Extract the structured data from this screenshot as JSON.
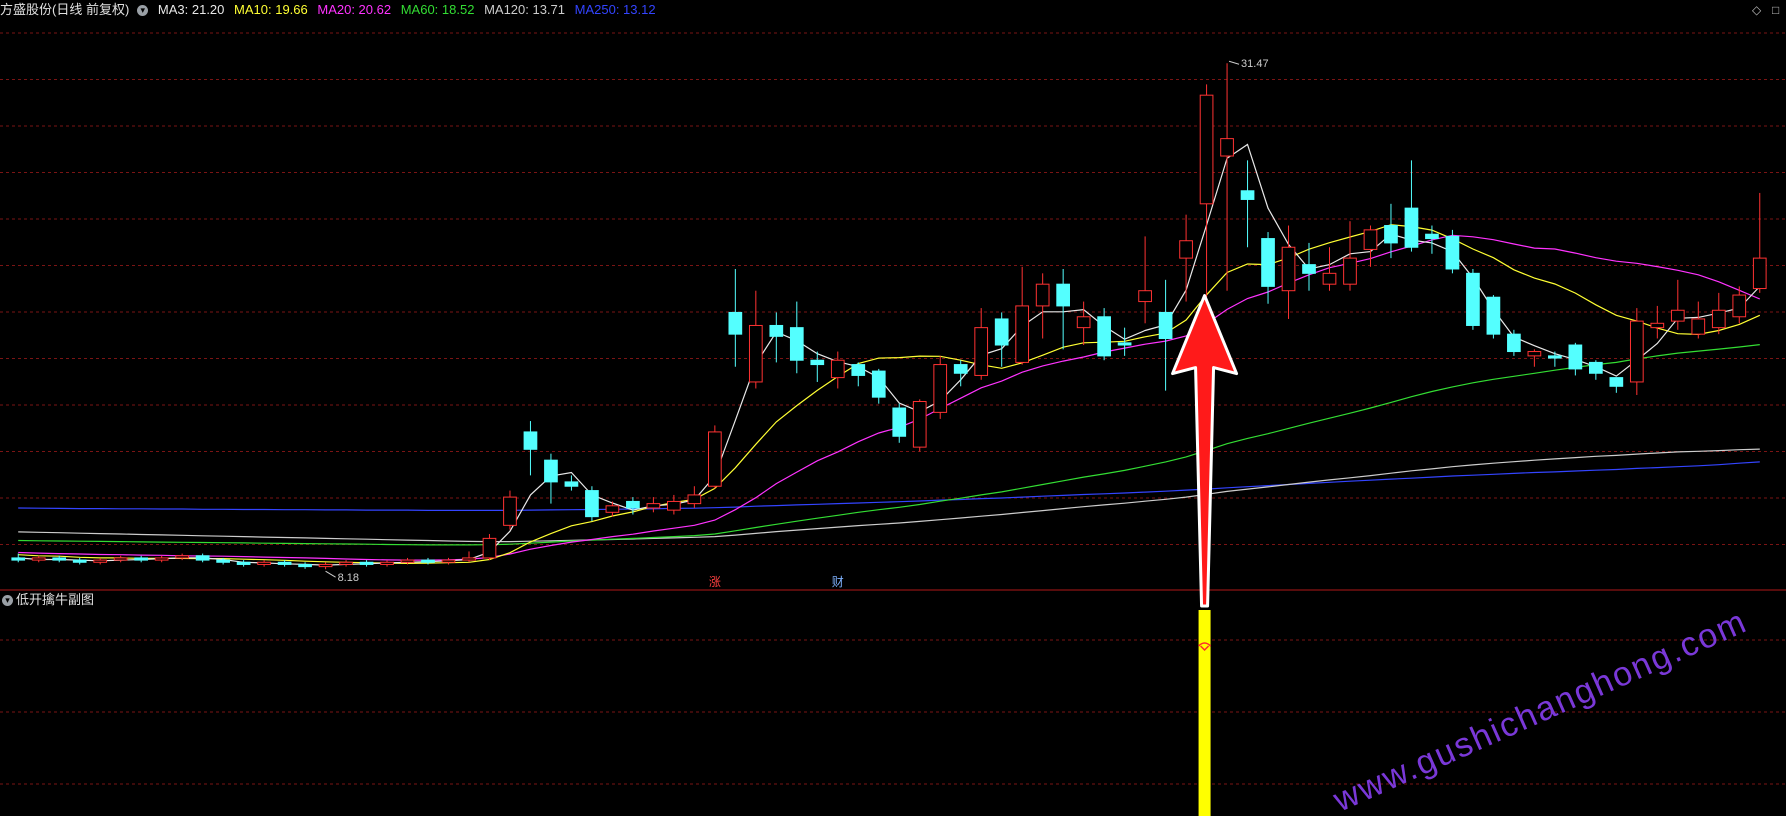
{
  "header": {
    "title": "方盛股份(日线 前复权)",
    "ma_labels": [
      {
        "text": "MA3: 21.20",
        "color": "#e8e8e8"
      },
      {
        "text": "MA10: 19.66",
        "color": "#ffff33"
      },
      {
        "text": "MA20: 20.62",
        "color": "#ff33ff"
      },
      {
        "text": "MA60: 18.52",
        "color": "#33dd33"
      },
      {
        "text": "MA120: 13.71",
        "color": "#cccccc"
      },
      {
        "text": "MA250: 13.12",
        "color": "#3344ff"
      }
    ]
  },
  "subchart": {
    "title": "低开擒牛副图"
  },
  "annotations": {
    "high_label": "31.47",
    "low_label": "8.18",
    "event_zhang": "涨",
    "event_cai": "财"
  },
  "watermark": "www.gushichanghong.com",
  "colors": {
    "up": "#ff3232",
    "down": "#54ffff",
    "grid": "#7a1414",
    "signal": "#ffff00",
    "arrow": "#ff1a1a"
  },
  "chart_data": {
    "type": "candlestick",
    "ylim": [
      7.5,
      33
    ],
    "grid": true,
    "high_marker": 31.47,
    "low_marker": 8.18,
    "candles": [
      [
        8.7,
        8.6,
        8.9,
        8.5
      ],
      [
        8.6,
        8.7,
        8.8,
        8.5
      ],
      [
        8.7,
        8.6,
        8.8,
        8.5
      ],
      [
        8.6,
        8.5,
        8.7,
        8.4
      ],
      [
        8.5,
        8.6,
        8.7,
        8.4
      ],
      [
        8.6,
        8.7,
        8.8,
        8.5
      ],
      [
        8.7,
        8.6,
        8.8,
        8.5
      ],
      [
        8.6,
        8.7,
        8.8,
        8.5
      ],
      [
        8.7,
        8.8,
        8.9,
        8.6
      ],
      [
        8.8,
        8.6,
        8.9,
        8.5
      ],
      [
        8.6,
        8.5,
        8.7,
        8.4
      ],
      [
        8.5,
        8.4,
        8.6,
        8.3
      ],
      [
        8.4,
        8.5,
        8.6,
        8.3
      ],
      [
        8.5,
        8.4,
        8.6,
        8.3
      ],
      [
        8.4,
        8.3,
        8.5,
        8.2
      ],
      [
        8.3,
        8.4,
        8.5,
        8.18
      ],
      [
        8.4,
        8.5,
        8.6,
        8.3
      ],
      [
        8.5,
        8.4,
        8.6,
        8.3
      ],
      [
        8.4,
        8.5,
        8.6,
        8.3
      ],
      [
        8.5,
        8.6,
        8.7,
        8.4
      ],
      [
        8.6,
        8.5,
        8.7,
        8.4
      ],
      [
        8.5,
        8.6,
        8.7,
        8.4
      ],
      [
        8.6,
        8.7,
        9.0,
        8.5
      ],
      [
        8.7,
        9.6,
        9.8,
        8.6
      ],
      [
        10.2,
        11.5,
        11.8,
        10.0
      ],
      [
        14.5,
        13.7,
        15.0,
        12.5
      ],
      [
        13.2,
        12.2,
        13.5,
        11.2
      ],
      [
        12.2,
        12.0,
        12.5,
        11.8
      ],
      [
        11.8,
        10.6,
        12.0,
        10.4
      ],
      [
        10.8,
        11.1,
        11.3,
        10.6
      ],
      [
        11.3,
        11.0,
        11.5,
        10.7
      ],
      [
        11.0,
        11.2,
        11.5,
        10.8
      ],
      [
        10.9,
        11.3,
        11.6,
        10.7
      ],
      [
        11.2,
        11.6,
        12.0,
        11.0
      ],
      [
        12.0,
        14.5,
        14.8,
        11.9
      ],
      [
        20.0,
        19.0,
        22.0,
        17.5
      ],
      [
        16.8,
        19.4,
        21.0,
        16.5
      ],
      [
        19.4,
        18.9,
        20.0,
        17.7
      ],
      [
        19.3,
        17.8,
        20.5,
        17.2
      ],
      [
        17.8,
        17.6,
        18.2,
        16.8
      ],
      [
        17.0,
        17.8,
        18.2,
        16.5
      ],
      [
        17.6,
        17.1,
        17.7,
        16.6
      ],
      [
        17.3,
        16.1,
        17.4,
        15.8
      ],
      [
        15.6,
        14.3,
        15.8,
        14.0
      ],
      [
        13.8,
        15.9,
        16.0,
        13.6
      ],
      [
        15.4,
        17.6,
        18.0,
        15.1
      ],
      [
        17.6,
        17.2,
        17.8,
        16.6
      ],
      [
        17.1,
        19.3,
        20.2,
        16.9
      ],
      [
        19.7,
        18.5,
        20.0,
        17.5
      ],
      [
        17.7,
        20.3,
        22.1,
        17.6
      ],
      [
        20.3,
        21.3,
        21.8,
        18.8
      ],
      [
        21.3,
        20.3,
        22.0,
        18.3
      ],
      [
        19.3,
        19.8,
        20.5,
        18.5
      ],
      [
        19.8,
        18.0,
        20.2,
        17.8
      ],
      [
        18.6,
        18.5,
        19.3,
        18.0
      ],
      [
        20.5,
        21.0,
        23.5,
        19.5
      ],
      [
        20.0,
        18.8,
        21.5,
        16.4
      ],
      [
        22.5,
        23.3,
        24.5,
        20.5
      ],
      [
        25.0,
        30.0,
        30.5,
        20.7
      ],
      [
        27.2,
        28.0,
        31.47,
        21.0
      ],
      [
        25.6,
        25.2,
        27.0,
        23.0
      ],
      [
        23.4,
        21.2,
        23.7,
        20.4
      ],
      [
        21.0,
        23.0,
        24.0,
        19.7
      ],
      [
        22.2,
        21.8,
        23.2,
        21.0
      ],
      [
        21.3,
        21.8,
        23.0,
        21.0
      ],
      [
        21.3,
        22.5,
        24.2,
        21.0
      ],
      [
        22.9,
        23.8,
        24.0,
        22.1
      ],
      [
        24.0,
        23.2,
        25.0,
        22.5
      ],
      [
        24.8,
        23.0,
        27.0,
        22.8
      ],
      [
        23.6,
        23.4,
        24.0,
        22.7
      ],
      [
        23.5,
        22.0,
        23.8,
        21.8
      ],
      [
        21.8,
        19.4,
        22.0,
        19.2
      ],
      [
        20.7,
        19.0,
        20.8,
        18.8
      ],
      [
        19.0,
        18.2,
        19.2,
        18.0
      ],
      [
        18.0,
        18.2,
        18.3,
        17.5
      ],
      [
        18.0,
        17.9,
        18.2,
        17.5
      ],
      [
        18.5,
        17.4,
        18.6,
        17.1
      ],
      [
        17.7,
        17.2,
        17.8,
        16.9
      ],
      [
        17.0,
        16.6,
        17.0,
        16.3
      ],
      [
        16.8,
        19.6,
        20.2,
        16.2
      ],
      [
        19.3,
        19.5,
        20.3,
        18.8
      ],
      [
        19.6,
        20.1,
        21.5,
        19.2
      ],
      [
        19.0,
        19.7,
        20.5,
        18.8
      ],
      [
        19.3,
        20.1,
        20.9,
        19.0
      ],
      [
        19.8,
        20.8,
        21.2,
        19.5
      ],
      [
        21.1,
        22.5,
        25.5,
        20.9
      ]
    ],
    "ma3": [
      8.7,
      8.63,
      8.63,
      8.6,
      8.57,
      8.6,
      8.63,
      8.67,
      8.7,
      8.7,
      8.63,
      8.5,
      8.47,
      8.43,
      8.4,
      8.37,
      8.4,
      8.43,
      8.47,
      8.5,
      8.53,
      8.57,
      8.63,
      8.97,
      9.93,
      11.6,
      12.47,
      12.63,
      11.6,
      11.23,
      10.9,
      11.1,
      11.17,
      11.37,
      12.47,
      15.03,
      17.63,
      19.1,
      18.7,
      18.1,
      17.73,
      17.5,
      17.0,
      15.83,
      15.43,
      15.93,
      16.9,
      18.03,
      18.33,
      19.37,
      20.03,
      20.03,
      20.13,
      19.37,
      18.77,
      19.17,
      19.43,
      21.03,
      24.03,
      27.1,
      27.73,
      24.8,
      23.13,
      22.0,
      22.2,
      22.7,
      22.8,
      23.6,
      23.33,
      23.2,
      22.8,
      21.6,
      20.13,
      18.87,
      18.47,
      18.1,
      17.83,
      17.5,
      17.07,
      17.8,
      18.57,
      19.73,
      19.77,
      19.97,
      20.2,
      21.2
    ],
    "ma10": [
      8.85,
      8.8,
      8.78,
      8.73,
      8.7,
      8.7,
      8.68,
      8.68,
      8.68,
      8.67,
      8.67,
      8.64,
      8.62,
      8.59,
      8.55,
      8.52,
      8.5,
      8.48,
      8.46,
      8.45,
      8.46,
      8.48,
      8.5,
      8.63,
      8.94,
      9.44,
      9.82,
      10.18,
      10.37,
      10.63,
      10.82,
      11.07,
      11.25,
      11.4,
      11.9,
      12.85,
      13.93,
      14.96,
      15.71,
      16.41,
      17.05,
      17.65,
      17.9,
      17.92,
      17.99,
      17.98,
      17.8,
      17.59,
      17.43,
      17.68,
      18.03,
      18.4,
      18.6,
      18.63,
      18.67,
      18.88,
      19.05,
      19.65,
      20.81,
      21.84,
      22.23,
      22.2,
      22.51,
      22.91,
      23.21,
      23.47,
      23.73,
      24.04,
      23.95,
      23.79,
      23.39,
      22.92,
      22.52,
      21.96,
      21.58,
      21.31,
      20.89,
      20.35,
      19.87,
      19.6,
      19.28,
      19.02,
      18.99,
      19.17,
      19.45,
      19.87
    ],
    "ma20": [
      8.95,
      8.92,
      8.9,
      8.88,
      8.86,
      8.85,
      8.83,
      8.82,
      8.8,
      8.79,
      8.78,
      8.76,
      8.74,
      8.72,
      8.7,
      8.68,
      8.65,
      8.63,
      8.61,
      8.6,
      8.6,
      8.61,
      8.64,
      8.72,
      8.88,
      9.1,
      9.27,
      9.43,
      9.55,
      9.68,
      9.79,
      9.94,
      10.07,
      10.2,
      10.44,
      10.92,
      11.47,
      12.12,
      12.65,
      13.17,
      13.58,
      14.05,
      14.45,
      14.71,
      15.09,
      15.58,
      16.05,
      16.53,
      16.84,
      17.25,
      17.54,
      17.76,
      17.95,
      18.18,
      18.36,
      18.54,
      18.68,
      18.92,
      19.49,
      20.14,
      20.64,
      20.94,
      21.35,
      21.73,
      22.06,
      22.26,
      22.48,
      22.79,
      23.06,
      23.34,
      23.55,
      23.48,
      23.35,
      23.15,
      22.96,
      22.92,
      22.73,
      22.52,
      22.36,
      22.26,
      22.11,
      21.94,
      21.73,
      21.41,
      21.02,
      20.62
    ],
    "ma60": [
      9.5,
      9.49,
      9.48,
      9.47,
      9.46,
      9.45,
      9.44,
      9.43,
      9.42,
      9.41,
      9.4,
      9.39,
      9.38,
      9.37,
      9.36,
      9.35,
      9.34,
      9.33,
      9.32,
      9.31,
      9.3,
      9.3,
      9.3,
      9.31,
      9.33,
      9.38,
      9.43,
      9.48,
      9.52,
      9.56,
      9.6,
      9.64,
      9.68,
      9.73,
      9.8,
      9.95,
      10.1,
      10.25,
      10.39,
      10.53,
      10.66,
      10.8,
      10.92,
      11.03,
      11.16,
      11.31,
      11.45,
      11.6,
      11.74,
      11.91,
      12.08,
      12.25,
      12.42,
      12.57,
      12.73,
      12.92,
      13.12,
      13.35,
      13.65,
      13.96,
      14.2,
      14.42,
      14.66,
      14.9,
      15.13,
      15.36,
      15.6,
      15.86,
      16.12,
      16.36,
      16.57,
      16.76,
      16.92,
      17.06,
      17.2,
      17.34,
      17.47,
      17.6,
      17.7,
      17.86,
      18.0,
      18.13,
      18.22,
      18.31,
      18.41,
      18.52
    ],
    "ma120": [
      9.9,
      9.88,
      9.86,
      9.84,
      9.82,
      9.8,
      9.78,
      9.76,
      9.74,
      9.72,
      9.7,
      9.68,
      9.66,
      9.64,
      9.62,
      9.6,
      9.58,
      9.56,
      9.54,
      9.52,
      9.5,
      9.48,
      9.46,
      9.45,
      9.45,
      9.47,
      9.49,
      9.51,
      9.53,
      9.55,
      9.57,
      9.6,
      9.62,
      9.65,
      9.68,
      9.75,
      9.83,
      9.91,
      9.98,
      10.05,
      10.12,
      10.19,
      10.25,
      10.31,
      10.38,
      10.46,
      10.54,
      10.62,
      10.7,
      10.79,
      10.88,
      10.97,
      11.06,
      11.14,
      11.22,
      11.31,
      11.4,
      11.5,
      11.63,
      11.76,
      11.87,
      11.97,
      12.08,
      12.19,
      12.29,
      12.39,
      12.49,
      12.6,
      12.71,
      12.8,
      12.9,
      12.98,
      13.06,
      13.13,
      13.2,
      13.26,
      13.32,
      13.38,
      13.42,
      13.48,
      13.53,
      13.58,
      13.61,
      13.64,
      13.68,
      13.71
    ],
    "ma250": [
      11.0,
      10.99,
      10.98,
      10.97,
      10.97,
      10.96,
      10.96,
      10.95,
      10.95,
      10.94,
      10.94,
      10.93,
      10.93,
      10.92,
      10.92,
      10.91,
      10.91,
      10.9,
      10.9,
      10.9,
      10.89,
      10.89,
      10.89,
      10.89,
      10.89,
      10.9,
      10.91,
      10.92,
      10.93,
      10.94,
      10.95,
      10.96,
      10.98,
      10.99,
      11.01,
      11.04,
      11.08,
      11.11,
      11.14,
      11.17,
      11.2,
      11.23,
      11.26,
      11.29,
      11.32,
      11.36,
      11.39,
      11.43,
      11.46,
      11.5,
      11.54,
      11.58,
      11.62,
      11.65,
      11.69,
      11.73,
      11.77,
      11.82,
      11.87,
      11.93,
      11.98,
      12.03,
      12.08,
      12.13,
      12.18,
      12.23,
      12.28,
      12.33,
      12.37,
      12.42,
      12.47,
      12.51,
      12.55,
      12.59,
      12.63,
      12.66,
      12.7,
      12.74,
      12.77,
      12.82,
      12.86,
      12.9,
      12.94,
      12.99,
      13.06,
      13.12
    ],
    "signal_index": 58,
    "event_indices": {
      "zhang": 34,
      "cai": 40
    }
  }
}
